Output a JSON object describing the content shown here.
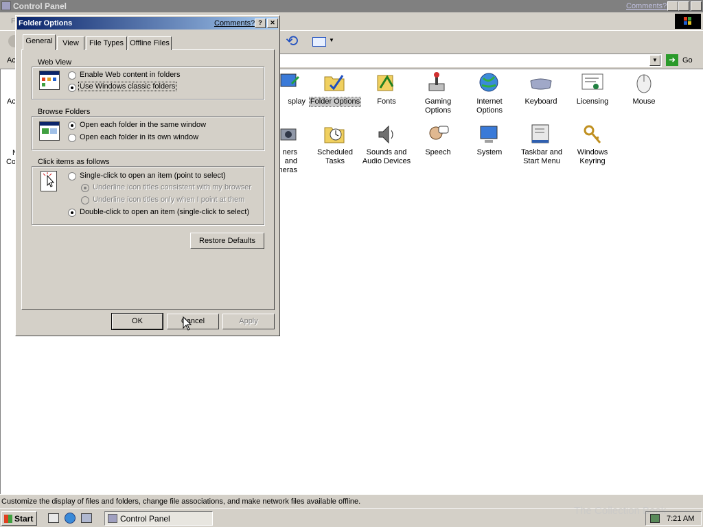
{
  "window": {
    "title": "Control Panel",
    "comments_link": "Comments?",
    "address_label": "Ac",
    "go_label": "Go",
    "status_text": "Customize the display of files and folders, change file associations, and make network files available offline.",
    "partial_left_labels": [
      "Ac",
      "N",
      "Co"
    ],
    "menu_partial": "F"
  },
  "icons": [
    {
      "label": "splay",
      "icon": "display-icon"
    },
    {
      "label": "Folder Options",
      "icon": "folder-options-icon"
    },
    {
      "label": "Fonts",
      "icon": "fonts-icon"
    },
    {
      "label": "Gaming Options",
      "icon": "gaming-options-icon"
    },
    {
      "label": "Internet Options",
      "icon": "internet-options-icon"
    },
    {
      "label": "Keyboard",
      "icon": "keyboard-icon"
    },
    {
      "label": "Licensing",
      "icon": "licensing-icon"
    },
    {
      "label": "Mouse",
      "icon": "mouse-icon"
    },
    {
      "label": "ners and meras",
      "icon": "scanners-cameras-icon"
    },
    {
      "label": "Scheduled Tasks",
      "icon": "scheduled-tasks-icon"
    },
    {
      "label": "Sounds and Audio Devices",
      "icon": "sounds-icon"
    },
    {
      "label": "Speech",
      "icon": "speech-icon"
    },
    {
      "label": "System",
      "icon": "system-icon"
    },
    {
      "label": "Taskbar and Start Menu",
      "icon": "taskbar-icon"
    },
    {
      "label": "Windows Keyring",
      "icon": "keyring-icon"
    }
  ],
  "dialog": {
    "title": "Folder Options",
    "comments_link": "Comments?",
    "tabs": [
      "General",
      "View",
      "File Types",
      "Offline Files"
    ],
    "web_view": {
      "legend": "Web View",
      "option1": "Enable Web content in folders",
      "option2": "Use Windows classic folders"
    },
    "browse": {
      "legend": "Browse Folders",
      "option1": "Open each folder in the same window",
      "option2": "Open each folder in its own window"
    },
    "click": {
      "legend": "Click items as follows",
      "option1": "Single-click to open an item (point to select)",
      "sub1": "Underline icon titles consistent with my browser",
      "sub2": "Underline icon titles only when I point at them",
      "option2": "Double-click to open an item (single-click to select)"
    },
    "restore_label": "Restore Defaults",
    "ok_label": "OK",
    "cancel_label": "Cancel",
    "apply_label": "Apply"
  },
  "taskbar": {
    "start_label": "Start",
    "task_label": "Control Panel",
    "clock": "7:21 AM",
    "watermark": "The Collection Book"
  }
}
